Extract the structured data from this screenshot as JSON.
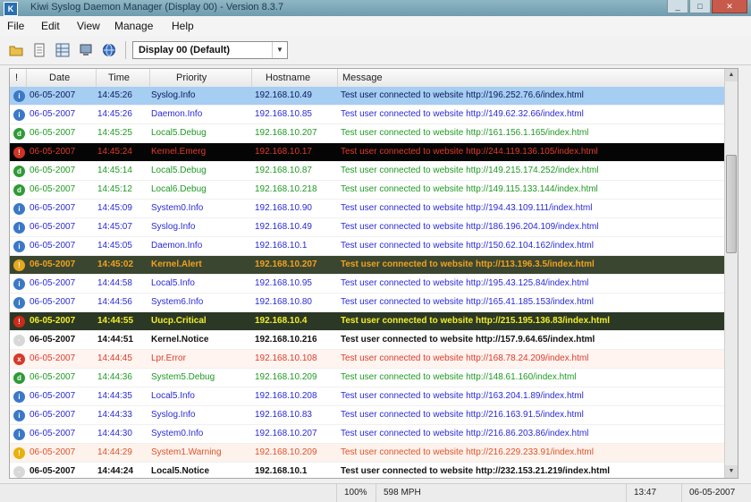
{
  "window": {
    "title": "Kiwi Syslog Daemon Manager (Display 00) - Version 8.3.7",
    "buttons": {
      "minimize": "_",
      "maximize": "□",
      "close": "✕"
    },
    "app_icon_label": "K"
  },
  "menu": [
    "File",
    "Edit",
    "View",
    "Manage",
    "Help"
  ],
  "toolbar": {
    "icons": [
      "folder-icon",
      "document-icon",
      "grid-icon",
      "computer-icon",
      "globe-icon"
    ],
    "display_select": "Display 00 (Default)"
  },
  "table": {
    "columns": [
      "!",
      "Date",
      "Time",
      "Priority",
      "Hostname",
      "Message"
    ],
    "rows": [
      {
        "severity": "info",
        "date": "06-05-2007",
        "time": "14:45:26",
        "priority": "Syslog.Info",
        "host": "192.168.10.49",
        "message": "Test user connected to website http://196.252.76.6/index.html",
        "style": "selected"
      },
      {
        "severity": "info",
        "date": "06-05-2007",
        "time": "14:45:26",
        "priority": "Daemon.Info",
        "host": "192.168.10.85",
        "message": "Test user connected to website http://149.62.32.66/index.html",
        "style": "info"
      },
      {
        "severity": "debug",
        "date": "06-05-2007",
        "time": "14:45:25",
        "priority": "Local5.Debug",
        "host": "192.168.10.207",
        "message": "Test user connected to website http://161.156.1.165/index.html",
        "style": "debug"
      },
      {
        "severity": "emergency",
        "date": "06-05-2007",
        "time": "14:45:24",
        "priority": "Kernel.Emerg",
        "host": "192.168.10.17",
        "message": "Test user connected to website http://244.119.136.105/index.html",
        "style": "emergency"
      },
      {
        "severity": "debug",
        "date": "06-05-2007",
        "time": "14:45:14",
        "priority": "Local5.Debug",
        "host": "192.168.10.87",
        "message": "Test user connected to website http://149.215.174.252/index.html",
        "style": "debug"
      },
      {
        "severity": "debug",
        "date": "06-05-2007",
        "time": "14:45:12",
        "priority": "Local6.Debug",
        "host": "192.168.10.218",
        "message": "Test user connected to website http://149.115.133.144/index.html",
        "style": "debug"
      },
      {
        "severity": "info",
        "date": "06-05-2007",
        "time": "14:45:09",
        "priority": "System0.Info",
        "host": "192.168.10.90",
        "message": "Test user connected to website http://194.43.109.111/index.html",
        "style": "info"
      },
      {
        "severity": "info",
        "date": "06-05-2007",
        "time": "14:45:07",
        "priority": "Syslog.Info",
        "host": "192.168.10.49",
        "message": "Test user connected to website http://186.196.204.109/index.html",
        "style": "info"
      },
      {
        "severity": "info",
        "date": "06-05-2007",
        "time": "14:45:05",
        "priority": "Daemon.Info",
        "host": "192.168.10.1",
        "message": "Test user connected to website http://150.62.104.162/index.html",
        "style": "info"
      },
      {
        "severity": "alert",
        "date": "06-05-2007",
        "time": "14:45:02",
        "priority": "Kernel.Alert",
        "host": "192.168.10.207",
        "message": "Test user connected to website http://113.196.3.5/index.html",
        "style": "alert"
      },
      {
        "severity": "info",
        "date": "06-05-2007",
        "time": "14:44:58",
        "priority": "Local5.Info",
        "host": "192.168.10.95",
        "message": "Test user connected to website http://195.43.125.84/index.html",
        "style": "info"
      },
      {
        "severity": "info",
        "date": "06-05-2007",
        "time": "14:44:56",
        "priority": "System6.Info",
        "host": "192.168.10.80",
        "message": "Test user connected to website http://165.41.185.153/index.html",
        "style": "info"
      },
      {
        "severity": "critical",
        "date": "06-05-2007",
        "time": "14:44:55",
        "priority": "Uucp.Critical",
        "host": "192.168.10.4",
        "message": "Test user connected to website http://215.195.136.83/index.html",
        "style": "critical"
      },
      {
        "severity": "notice",
        "date": "06-05-2007",
        "time": "14:44:51",
        "priority": "Kernel.Notice",
        "host": "192.168.10.216",
        "message": "Test user connected to website http://157.9.64.65/index.html",
        "style": "notice"
      },
      {
        "severity": "error",
        "date": "06-05-2007",
        "time": "14:44:45",
        "priority": "Lpr.Error",
        "host": "192.168.10.108",
        "message": "Test user connected to website http://168.78.24.209/index.html",
        "style": "error"
      },
      {
        "severity": "debug",
        "date": "06-05-2007",
        "time": "14:44:36",
        "priority": "System5.Debug",
        "host": "192.168.10.209",
        "message": "Test user connected to website http://148.61.160/index.html",
        "style": "debug"
      },
      {
        "severity": "info",
        "date": "06-05-2007",
        "time": "14:44:35",
        "priority": "Local5.Info",
        "host": "192.168.10.208",
        "message": "Test user connected to website http://163.204.1.89/index.html",
        "style": "info"
      },
      {
        "severity": "info",
        "date": "06-05-2007",
        "time": "14:44:33",
        "priority": "Syslog.Info",
        "host": "192.168.10.83",
        "message": "Test user connected to website http://216.163.91.5/index.html",
        "style": "info"
      },
      {
        "severity": "info",
        "date": "06-05-2007",
        "time": "14:44:30",
        "priority": "System0.Info",
        "host": "192.168.10.207",
        "message": "Test user connected to website http://216.86.203.86/index.html",
        "style": "info"
      },
      {
        "severity": "warning",
        "date": "06-05-2007",
        "time": "14:44:29",
        "priority": "System1.Warning",
        "host": "192.168.10.209",
        "message": "Test user connected to website http://216.229.233.91/index.html",
        "style": "warning"
      },
      {
        "severity": "notice",
        "date": "06-05-2007",
        "time": "14:44:24",
        "priority": "Local5.Notice",
        "host": "192.168.10.1",
        "message": "Test user connected to website http://232.153.21.219/index.html",
        "style": "notice"
      }
    ]
  },
  "status": {
    "pct": "100%",
    "rate": "598 MPH",
    "time": "13:47",
    "date": "06-05-2007"
  },
  "styles": {
    "selected": {
      "bg": "#a6cdf2",
      "fg": "#0a1b5a",
      "bold": false
    },
    "info": {
      "bg": "#ffffff",
      "fg": "#2a2ad8",
      "bold": false
    },
    "debug": {
      "bg": "#ffffff",
      "fg": "#1f9a22",
      "bold": false
    },
    "emergency": {
      "bg": "#050505",
      "fg": "#e23b2a",
      "bold": false
    },
    "alert": {
      "bg": "#3b4630",
      "fg": "#f0a21e",
      "bold": true
    },
    "critical": {
      "bg": "#2c3826",
      "fg": "#f4ef2a",
      "bold": true
    },
    "notice": {
      "bg": "#ffffff",
      "fg": "#111111",
      "bold": true
    },
    "error": {
      "bg": "#fff4f0",
      "fg": "#de3b2a",
      "bold": false
    },
    "warning": {
      "bg": "#fdf3ec",
      "fg": "#e2512b",
      "bold": false
    }
  },
  "severity_icons": {
    "info": {
      "name": "info-icon",
      "bg": "#3a78c8",
      "glyph": "i"
    },
    "debug": {
      "name": "debug-icon",
      "bg": "#2f9a36",
      "glyph": "d"
    },
    "emergency": {
      "name": "emergency-icon",
      "bg": "#d23222",
      "glyph": "!"
    },
    "alert": {
      "name": "alert-icon",
      "bg": "#e6a91c",
      "glyph": "!"
    },
    "critical": {
      "name": "critical-icon",
      "bg": "#cc2a1a",
      "glyph": "!"
    },
    "notice": {
      "name": "notice-icon",
      "bg": "#d8d8d8",
      "glyph": "·"
    },
    "error": {
      "name": "error-icon",
      "bg": "#d33b2a",
      "glyph": "x"
    },
    "warning": {
      "name": "warning-icon",
      "bg": "#e8b10c",
      "glyph": "!"
    }
  }
}
